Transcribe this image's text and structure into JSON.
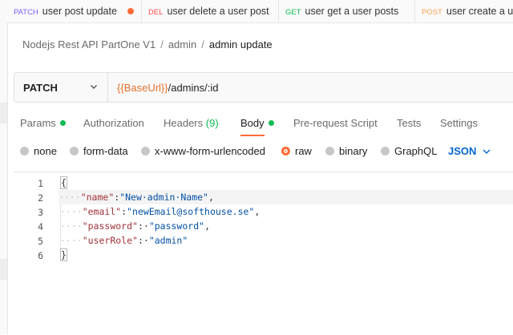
{
  "tabs": [
    {
      "method": "PATCH",
      "method_color": "#7b61ff",
      "title": "user post update",
      "dot": true
    },
    {
      "method": "DEL",
      "method_color": "#ff4f4f",
      "title": "user delete a user post",
      "dot": false
    },
    {
      "method": "GET",
      "method_color": "#0cbb52",
      "title": "user get a user posts",
      "dot": false
    },
    {
      "method": "POST",
      "method_color": "#ffa24e",
      "title": "user create a u",
      "dot": false
    }
  ],
  "breadcrumb": {
    "collection": "Nodejs Rest API PartOne V1",
    "folder": "admin",
    "request": "admin update"
  },
  "request": {
    "method": "PATCH",
    "url_variable": "{{BaseUrl}}",
    "url_path": "/admins/:id"
  },
  "request_tabs": {
    "params": "Params",
    "authorization": "Authorization",
    "headers": "Headers",
    "headers_count": "(9)",
    "body": "Body",
    "pre_request": "Pre-request Script",
    "tests": "Tests",
    "settings": "Settings"
  },
  "body_types": {
    "none": "none",
    "form_data": "form-data",
    "urlencoded": "x-www-form-urlencoded",
    "raw": "raw",
    "binary": "binary",
    "graphql": "GraphQL",
    "selected": "raw",
    "language": "JSON"
  },
  "editor": {
    "line_numbers": [
      "1",
      "2",
      "3",
      "4",
      "5",
      "6"
    ],
    "open_brace": "{",
    "close_brace": "}",
    "lines": [
      {
        "dots": "····",
        "key": "\"name\"",
        "sep": ":",
        "value": "\"New·admin·Name\"",
        "end": ","
      },
      {
        "dots": "····",
        "key": "\"email\"",
        "sep": ":",
        "value": "\"newEmail@softhouse.se\"",
        "end": ","
      },
      {
        "dots": "····",
        "key": "\"password\"",
        "sep": ":·",
        "value": "\"password\"",
        "end": ","
      },
      {
        "dots": "····",
        "key": "\"userRole\"",
        "sep": ":·",
        "value": "\"admin\"",
        "end": ""
      }
    ]
  },
  "colors": {
    "accent": "#ff6c37",
    "success": "#0cbb52",
    "link": "#0265d2"
  }
}
